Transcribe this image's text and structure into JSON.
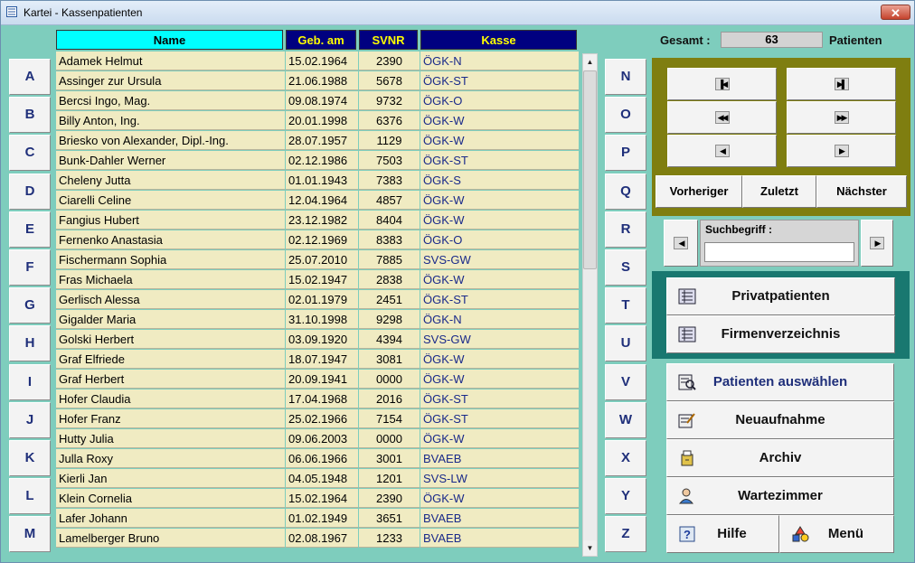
{
  "window": {
    "title": "Kartei - Kassenpatienten",
    "close_label": "✕"
  },
  "letters_left": [
    "A",
    "B",
    "C",
    "D",
    "E",
    "F",
    "G",
    "H",
    "I",
    "J",
    "K",
    "L",
    "M"
  ],
  "letters_right": [
    "N",
    "O",
    "P",
    "Q",
    "R",
    "S",
    "T",
    "U",
    "V",
    "W",
    "X",
    "Y",
    "Z"
  ],
  "table": {
    "headers": {
      "name": "Name",
      "geb": "Geb. am",
      "svnr": "SVNR",
      "kasse": "Kasse"
    },
    "rows": [
      {
        "name": "Adamek Helmut",
        "geb": "15.02.1964",
        "svnr": "2390",
        "kasse": "ÖGK-N"
      },
      {
        "name": "Assinger zur Ursula",
        "geb": "21.06.1988",
        "svnr": "5678",
        "kasse": "ÖGK-ST"
      },
      {
        "name": "Bercsi Ingo, Mag.",
        "geb": "09.08.1974",
        "svnr": "9732",
        "kasse": "ÖGK-O"
      },
      {
        "name": "Billy Anton, Ing.",
        "geb": "20.01.1998",
        "svnr": "6376",
        "kasse": "ÖGK-W"
      },
      {
        "name": "Briesko von Alexander, Dipl.-Ing.",
        "geb": "28.07.1957",
        "svnr": "1129",
        "kasse": "ÖGK-W"
      },
      {
        "name": "Bunk-Dahler Werner",
        "geb": "02.12.1986",
        "svnr": "7503",
        "kasse": "ÖGK-ST"
      },
      {
        "name": "Cheleny Jutta",
        "geb": "01.01.1943",
        "svnr": "7383",
        "kasse": "ÖGK-S"
      },
      {
        "name": "Ciarelli Celine",
        "geb": "12.04.1964",
        "svnr": "4857",
        "kasse": "ÖGK-W"
      },
      {
        "name": "Fangius Hubert",
        "geb": "23.12.1982",
        "svnr": "8404",
        "kasse": "ÖGK-W"
      },
      {
        "name": "Fernenko Anastasia",
        "geb": "02.12.1969",
        "svnr": "8383",
        "kasse": "ÖGK-O"
      },
      {
        "name": "Fischermann Sophia",
        "geb": "25.07.2010",
        "svnr": "7885",
        "kasse": "SVS-GW"
      },
      {
        "name": "Fras Michaela",
        "geb": "15.02.1947",
        "svnr": "2838",
        "kasse": "ÖGK-W"
      },
      {
        "name": "Gerlisch Alessa",
        "geb": "02.01.1979",
        "svnr": "2451",
        "kasse": "ÖGK-ST"
      },
      {
        "name": "Gigalder Maria",
        "geb": "31.10.1998",
        "svnr": "9298",
        "kasse": "ÖGK-N"
      },
      {
        "name": "Golski Herbert",
        "geb": "03.09.1920",
        "svnr": "4394",
        "kasse": "SVS-GW"
      },
      {
        "name": "Graf Elfriede",
        "geb": "18.07.1947",
        "svnr": "3081",
        "kasse": "ÖGK-W"
      },
      {
        "name": "Graf Herbert",
        "geb": "20.09.1941",
        "svnr": "0000",
        "kasse": "ÖGK-W"
      },
      {
        "name": "Hofer Claudia",
        "geb": "17.04.1968",
        "svnr": "2016",
        "kasse": "ÖGK-ST"
      },
      {
        "name": "Hofer Franz",
        "geb": "25.02.1966",
        "svnr": "7154",
        "kasse": "ÖGK-ST"
      },
      {
        "name": "Hutty Julia",
        "geb": "09.06.2003",
        "svnr": "0000",
        "kasse": "ÖGK-W"
      },
      {
        "name": "Julla Roxy",
        "geb": "06.06.1966",
        "svnr": "3001",
        "kasse": "BVAEB"
      },
      {
        "name": "Kierli Jan",
        "geb": "04.05.1948",
        "svnr": "1201",
        "kasse": "SVS-LW"
      },
      {
        "name": "Klein Cornelia",
        "geb": "15.02.1964",
        "svnr": "2390",
        "kasse": "ÖGK-W"
      },
      {
        "name": "Lafer Johann",
        "geb": "01.02.1949",
        "svnr": "3651",
        "kasse": "BVAEB"
      },
      {
        "name": "Lamelberger Bruno",
        "geb": "02.08.1967",
        "svnr": "1233",
        "kasse": "BVAEB"
      }
    ]
  },
  "scrollbar": {
    "up": "▲",
    "down": "▼"
  },
  "summary": {
    "label": "Gesamt :",
    "value": "63",
    "unit": "Patienten"
  },
  "nav": {
    "first": "▐◀",
    "last": "▶▌",
    "prev_page": "◀◀",
    "next_page": "▶▶",
    "prev": "◀",
    "next": "▶",
    "vorheriger": "Vorheriger",
    "zuletzt": "Zuletzt",
    "naechster": "Nächster"
  },
  "search": {
    "label": "Suchbegriff :",
    "value": "",
    "left": "◀",
    "right": "▶"
  },
  "buttons": {
    "privat": "Privatpatienten",
    "firmen": "Firmenverzeichnis",
    "auswaehlen": "Patienten auswählen",
    "neu": "Neuaufnahme",
    "archiv": "Archiv",
    "warte": "Wartezimmer",
    "hilfe": "Hilfe",
    "menu": "Menü"
  },
  "colors": {
    "background": "#7ecdbd",
    "header_dark": "#000080",
    "header_text": "#ffff00",
    "name_header": "#00ffff",
    "row_bg": "#f0ebc2",
    "nav_panel": "#7f7e10",
    "teal_panel": "#197870"
  }
}
